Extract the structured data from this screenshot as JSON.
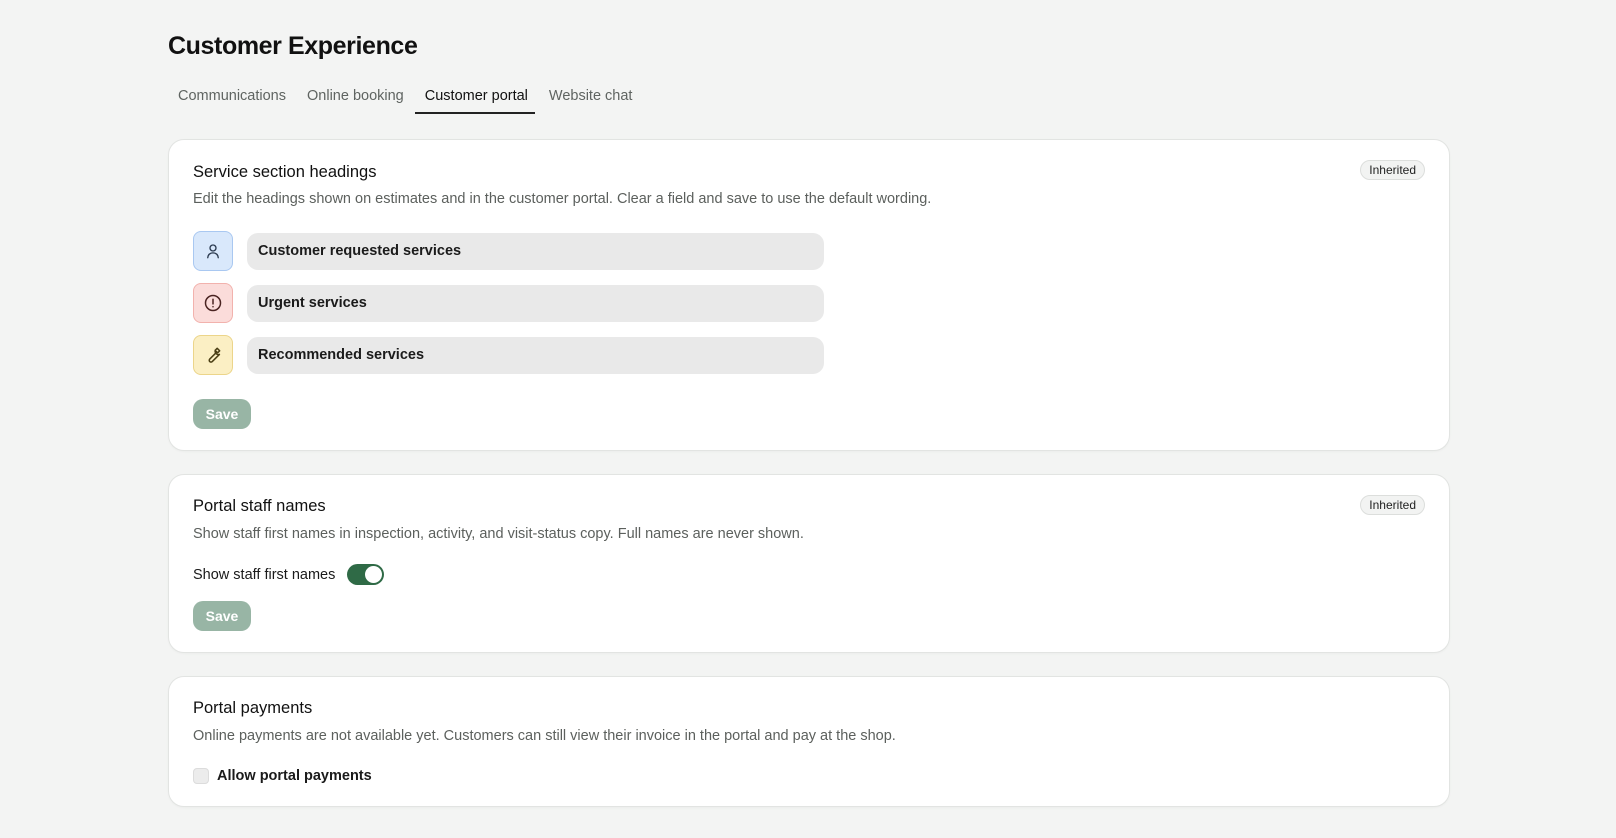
{
  "page": {
    "title": "Customer Experience"
  },
  "tabs": [
    {
      "label": "Communications",
      "active": false
    },
    {
      "label": "Online booking",
      "active": false
    },
    {
      "label": "Customer portal",
      "active": true
    },
    {
      "label": "Website chat",
      "active": false
    }
  ],
  "service_headings": {
    "title": "Service section headings",
    "badge": "Inherited",
    "description": "Edit the headings shown on estimates and in the customer portal. Clear a field and save to use the default wording.",
    "fields": [
      {
        "icon": "user-icon",
        "value": "Customer requested services",
        "color": "#d9e8fb"
      },
      {
        "icon": "alert-circle-icon",
        "value": "Urgent services",
        "color": "#fbdcda"
      },
      {
        "icon": "wrench-icon",
        "value": "Recommended services",
        "color": "#fbefc4"
      }
    ],
    "save_label": "Save"
  },
  "staff_names": {
    "title": "Portal staff names",
    "badge": "Inherited",
    "description": "Show staff first names in inspection, activity, and visit-status copy. Full names are never shown.",
    "toggle_label": "Show staff first names",
    "toggle_on": true,
    "save_label": "Save"
  },
  "payments": {
    "title": "Portal payments",
    "description": "Online payments are not available yet. Customers can still view their invoice in the portal and pay at the shop.",
    "checkbox_label": "Allow portal payments",
    "checked": false
  },
  "colors": {
    "accent": "#2f6a46",
    "save_disabled": "#98b5a5",
    "background": "#f3f4f3"
  }
}
